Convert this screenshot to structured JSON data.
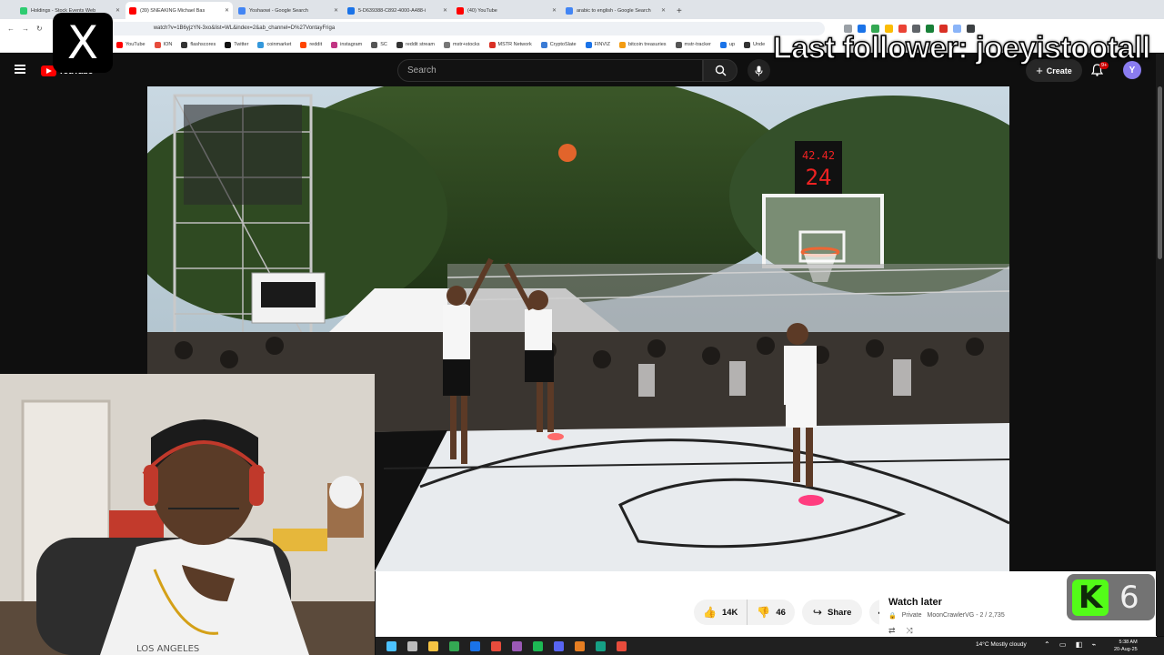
{
  "browser": {
    "tabs": [
      {
        "title": "Holdings - Stock Events Web",
        "color": "#2ecc71"
      },
      {
        "title": "(39) SNEAKING Michael Bas",
        "color": "#ff0000",
        "active": true
      },
      {
        "title": "Yoshaowi - Google Search",
        "color": "#4285f4"
      },
      {
        "title": "5-D639388-C892-4000-A488-i",
        "color": "#1a73e8"
      },
      {
        "title": "(40) YouTube",
        "color": "#ff0000"
      },
      {
        "title": "arabic to english - Google Search",
        "color": "#4285f4"
      }
    ],
    "new_tab": "+",
    "url": "watch?v=1B6yjzYN-3xo&list=WL&index=2&ab_channel=D%27VontayFriga",
    "bookmarks": [
      "YouTube",
      "ION",
      "flashscores",
      "Twitter",
      "coinmarket",
      "reddit",
      "instagram",
      "SC",
      "reddit stream",
      "mstr+stocks",
      "MSTR Network",
      "CryptoSlate",
      "FINVIZ",
      "bitcoin treasuries",
      "mstr-tracker",
      "up",
      "Unde"
    ]
  },
  "overlay": {
    "follower_text": "Last follower: joeyistootall",
    "x_logo": "X",
    "kick_logo": "K",
    "kick_count": "6"
  },
  "youtube": {
    "logo_text": "YouTube",
    "search_placeholder": "Search",
    "create_label": "Create",
    "notif_badge": "9+",
    "avatar_letter": "Y",
    "likes": "14K",
    "dislikes": "46",
    "share_label": "Share",
    "more_label": "⋯",
    "playlist": {
      "title": "Watch later",
      "privacy": "Private",
      "owner_progress": "MoonCrawlerVG - 2 / 2,735"
    }
  },
  "taskbar": {
    "weather": "14°C  Mostly cloudy",
    "time": "5:38 AM",
    "date": "20-Aug-25"
  },
  "colors": {
    "yt_red": "#ff0000",
    "kick_green": "#53fc18",
    "court_white": "#e8ebee"
  }
}
